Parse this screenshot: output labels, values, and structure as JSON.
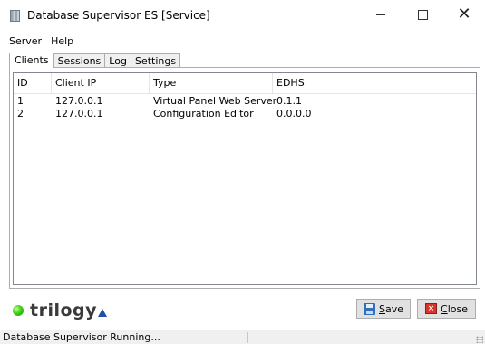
{
  "window": {
    "title": "Database Supervisor ES [Service]",
    "icon": "database-icon",
    "controls": {
      "minimize": "minimize-icon",
      "maximize": "maximize-icon",
      "close": "✕"
    }
  },
  "menu": [
    "Server",
    "Help"
  ],
  "tabs": [
    "Clients",
    "Sessions",
    "Log",
    "Settings"
  ],
  "active_tab": "Clients",
  "table": {
    "columns": [
      "ID",
      "Client IP",
      "Type",
      "EDHS"
    ],
    "rows": [
      [
        "1",
        "127.0.0.1",
        "Virtual Panel Web Server",
        "0.1.1"
      ],
      [
        "2",
        "127.0.0.1",
        "Configuration Editor",
        "0.0.0.0"
      ]
    ]
  },
  "logo": {
    "text": "trilogy",
    "status_color": "#3ed411"
  },
  "buttons": {
    "save": {
      "label_first": "S",
      "label_rest": "ave",
      "icon": "save-icon"
    },
    "close": {
      "label_first": "C",
      "label_rest": "lose",
      "icon": "close-icon"
    }
  },
  "status": {
    "text": "Database Supervisor Running..."
  }
}
